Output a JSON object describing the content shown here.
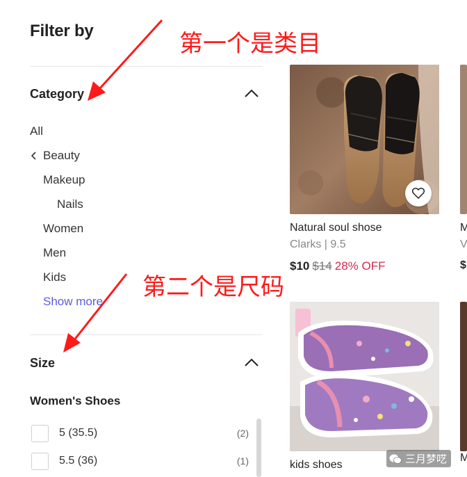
{
  "filter": {
    "title": "Filter by",
    "category": {
      "heading": "Category",
      "items": [
        "All",
        "Beauty",
        "Makeup",
        "Nails",
        "Women",
        "Men",
        "Kids"
      ],
      "show_more": "Show more"
    },
    "size": {
      "heading": "Size",
      "subheading": "Women's Shoes",
      "options": [
        {
          "label": "5 (35.5)",
          "count": "(2)"
        },
        {
          "label": "5.5 (36)",
          "count": "(1)"
        }
      ]
    }
  },
  "annotations": {
    "first": "第一个是类目",
    "second": "第二个是尺码"
  },
  "products": [
    {
      "title": "Natural soul shose",
      "brand": "Clarks | 9.5",
      "price": "$10",
      "original_price": "$14",
      "discount": "28% OFF"
    },
    {
      "title": "kids shoes"
    }
  ],
  "edge_products": [
    {
      "title": "M",
      "brand": "V",
      "price": "$"
    },
    {
      "title": "M"
    }
  ],
  "watermark": "三月梦呓",
  "colors": {
    "link": "#5b5ce2",
    "discount": "#d12b4f",
    "annotation": "#ff1a1a"
  }
}
